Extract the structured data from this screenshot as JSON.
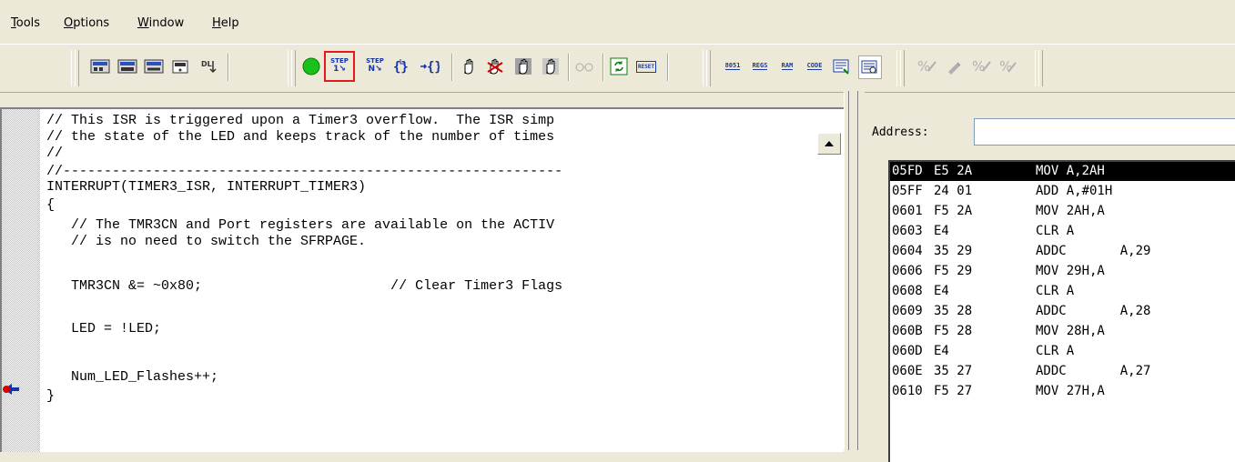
{
  "menu": {
    "items": [
      {
        "label": "Tools",
        "accel": "T",
        "rest": "ools"
      },
      {
        "label": "Options",
        "accel": "O",
        "rest": "ptions"
      },
      {
        "label": "Window",
        "accel": "W",
        "rest": "indow"
      },
      {
        "label": "Help",
        "accel": "H",
        "rest": "elp"
      }
    ]
  },
  "toolbar": {
    "step_label": "STEP",
    "step_num": "1",
    "step_over_label": "STEP",
    "reset_label": "RESET",
    "view_8051": "8051",
    "view_regs": "REGS",
    "view_ram": "RAM",
    "view_code": "CODE",
    "highlight_color": "#e31b1b"
  },
  "editor": {
    "lines": [
      "// This ISR is triggered upon a Timer3 overflow.  The ISR simp",
      "// the state of the LED and keeps track of the number of times",
      "//",
      "//-------------------------------------------------------------",
      "INTERRUPT(TIMER3_ISR, INTERRUPT_TIMER3)",
      "{",
      "   // The TMR3CN and Port registers are available on the ACTIV",
      "   // is no need to switch the SFRPAGE.",
      "",
      "   TMR3CN &= ~0x80;                       // Clear Timer3 Flags",
      "",
      "   LED = !LED;",
      "",
      "   Num_LED_Flashes++;",
      "}"
    ]
  },
  "disassembly": {
    "address_label": "Address:",
    "address_value": "",
    "rows": [
      {
        "addr": "05FD",
        "bytes": "E5 2A",
        "inst": "MOV A,2AH",
        "selected": true
      },
      {
        "addr": "05FF",
        "bytes": "24 01",
        "inst": "ADD A,#01H"
      },
      {
        "addr": "0601",
        "bytes": "F5 2A",
        "inst": "MOV 2AH,A"
      },
      {
        "addr": "0603",
        "bytes": "E4",
        "inst": "CLR A"
      },
      {
        "addr": "0604",
        "bytes": "35 29",
        "inst": "ADDC       A,29"
      },
      {
        "addr": "0606",
        "bytes": "F5 29",
        "inst": "MOV 29H,A"
      },
      {
        "addr": "0608",
        "bytes": "E4",
        "inst": "CLR A"
      },
      {
        "addr": "0609",
        "bytes": "35 28",
        "inst": "ADDC       A,28"
      },
      {
        "addr": "060B",
        "bytes": "F5 28",
        "inst": "MOV 28H,A"
      },
      {
        "addr": "060D",
        "bytes": "E4",
        "inst": "CLR A"
      },
      {
        "addr": "060E",
        "bytes": "35 27",
        "inst": "ADDC       A,27"
      },
      {
        "addr": "0610",
        "bytes": "F5 27",
        "inst": "MOV 27H,A"
      }
    ]
  }
}
